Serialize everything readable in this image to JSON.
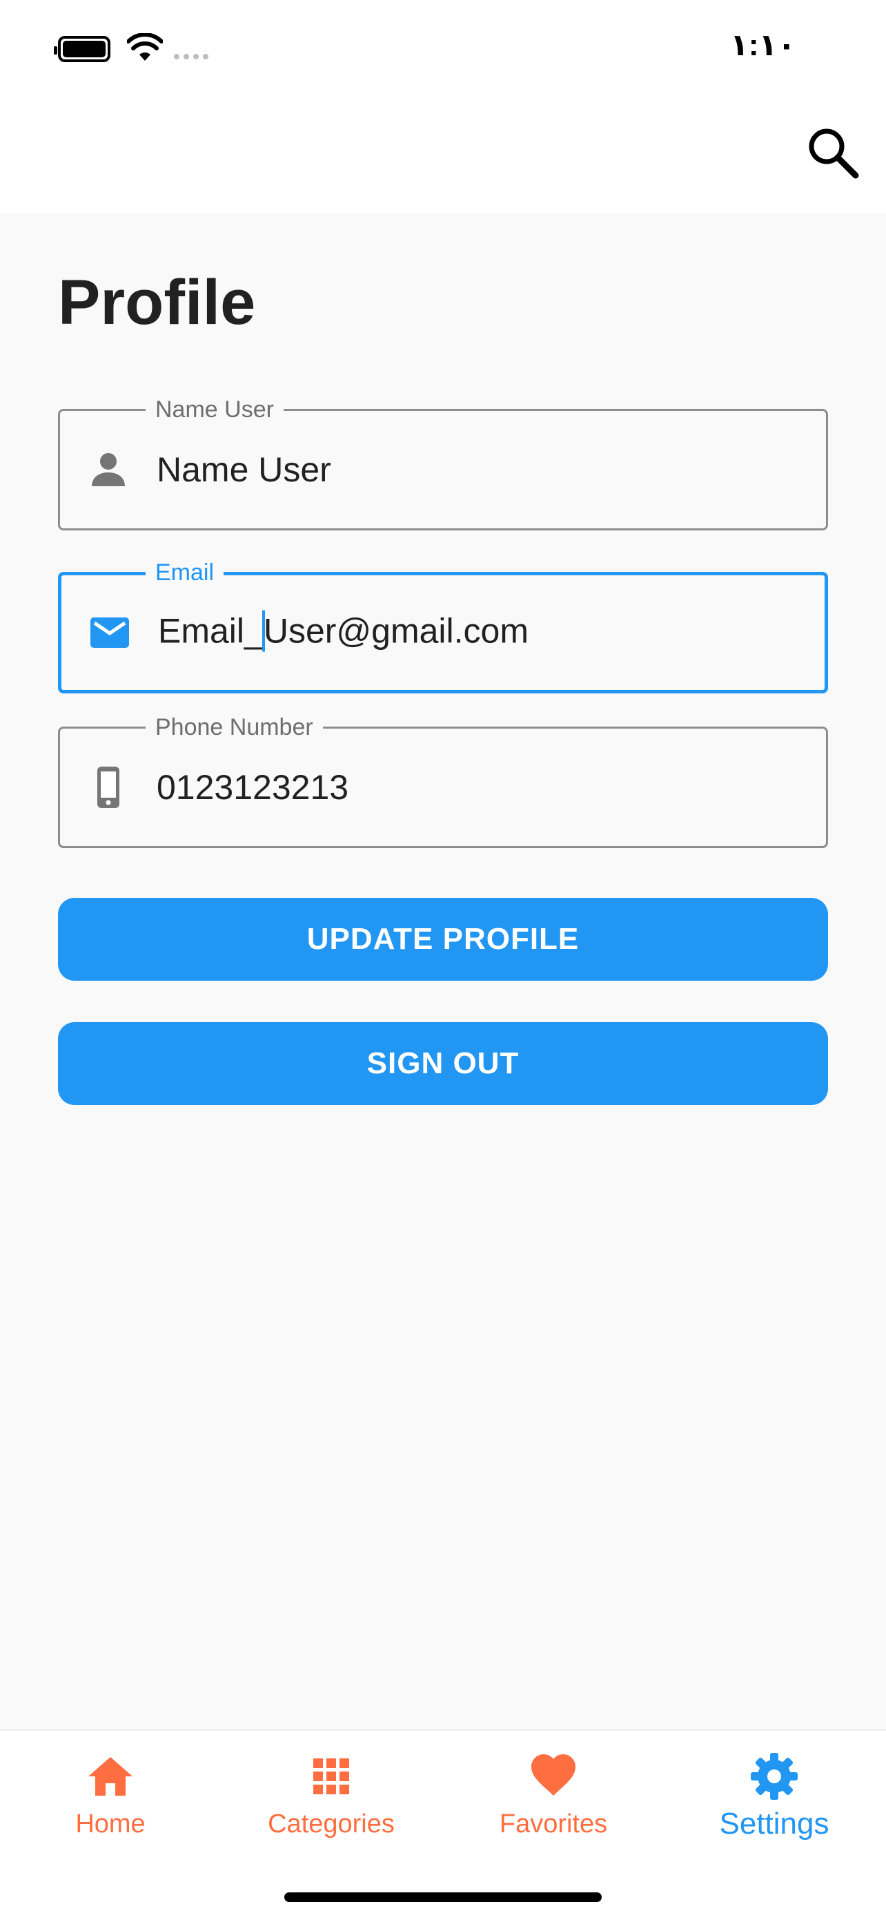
{
  "status_bar": {
    "time": "١:١٠",
    "battery_icon": "battery-full-icon",
    "wifi_icon": "wifi-icon",
    "signal_icon": "cellular-signal-icon"
  },
  "app_bar": {
    "search_icon": "search-icon"
  },
  "page": {
    "title": "Profile"
  },
  "form": {
    "name": {
      "label": "Name User",
      "value": "Name User",
      "icon": "person-icon"
    },
    "email": {
      "label": "Email",
      "value_before_caret": "Email_",
      "value_after_caret": "User@gmail.com",
      "icon": "mail-icon",
      "focused": true
    },
    "phone": {
      "label": "Phone Number",
      "value": "0123123213",
      "icon": "smartphone-icon"
    }
  },
  "buttons": {
    "update": "UPDATE PROFILE",
    "sign_out": "SIGN OUT"
  },
  "bottom_nav": {
    "items": [
      {
        "label": "Home",
        "icon": "home-icon",
        "active": false
      },
      {
        "label": "Categories",
        "icon": "grid-icon",
        "active": false
      },
      {
        "label": "Favorites",
        "icon": "heart-icon",
        "active": false
      },
      {
        "label": "Settings",
        "icon": "gear-icon",
        "active": true
      }
    ]
  },
  "colors": {
    "primary": "#2196f3",
    "inactive_nav": "#ff6e40",
    "background": "#f9f9f9",
    "field_border": "#8d8d8d"
  }
}
